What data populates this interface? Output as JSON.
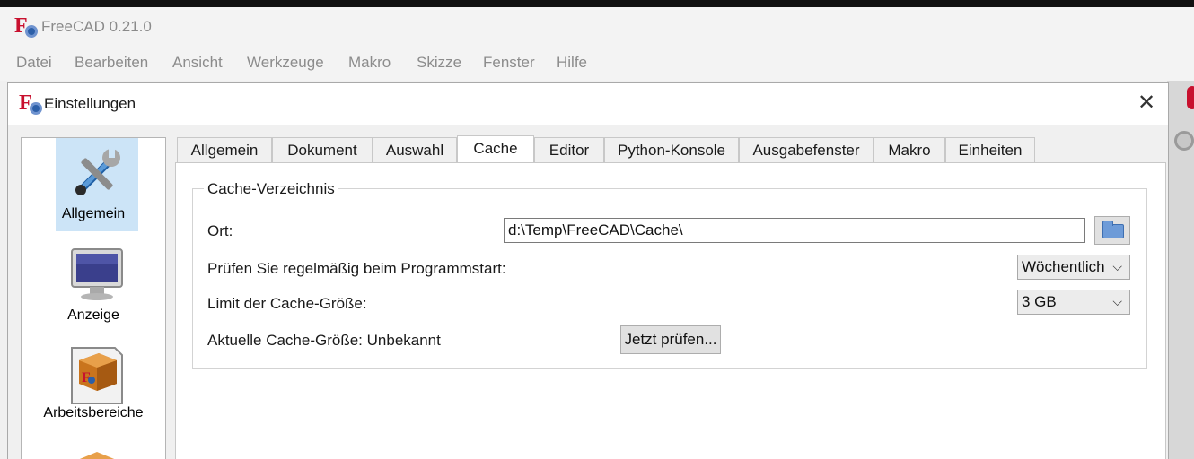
{
  "app": {
    "title": "FreeCAD 0.21.0",
    "menu": [
      "Datei",
      "Bearbeiten",
      "Ansicht",
      "Werkzeuge",
      "Makro",
      "Skizze",
      "Fenster",
      "Hilfe"
    ]
  },
  "dialog": {
    "title": "Einstellungen",
    "close_label": "✕",
    "categories": [
      {
        "label": "Allgemein",
        "icon": "tools-icon",
        "selected": true
      },
      {
        "label": "Anzeige",
        "icon": "monitor-icon",
        "selected": false
      },
      {
        "label": "Arbeitsbereiche",
        "icon": "workbench-icon",
        "selected": false
      },
      {
        "label": "",
        "icon": "box-icon",
        "selected": false
      }
    ],
    "tabs": [
      "Allgemein",
      "Dokument",
      "Auswahl",
      "Cache",
      "Editor",
      "Python-Konsole",
      "Ausgabefenster",
      "Makro",
      "Einheiten"
    ],
    "active_tab": "Cache",
    "cache": {
      "group_title": "Cache-Verzeichnis",
      "location_label": "Ort:",
      "location_value": "d:\\Temp\\FreeCAD\\Cache\\",
      "check_label": "Prüfen Sie regelmäßig beim Programmstart:",
      "check_value": "Wöchentlich",
      "limit_label": "Limit der Cache-Größe:",
      "limit_value": "3 GB",
      "current_label": "Aktuelle Cache-Größe: Unbekannt",
      "check_now_button": "Jetzt prüfen..."
    }
  },
  "colors": {
    "selection": "#cce4f7",
    "logo_red": "#c8102e",
    "logo_blue": "#2c5fa8"
  }
}
